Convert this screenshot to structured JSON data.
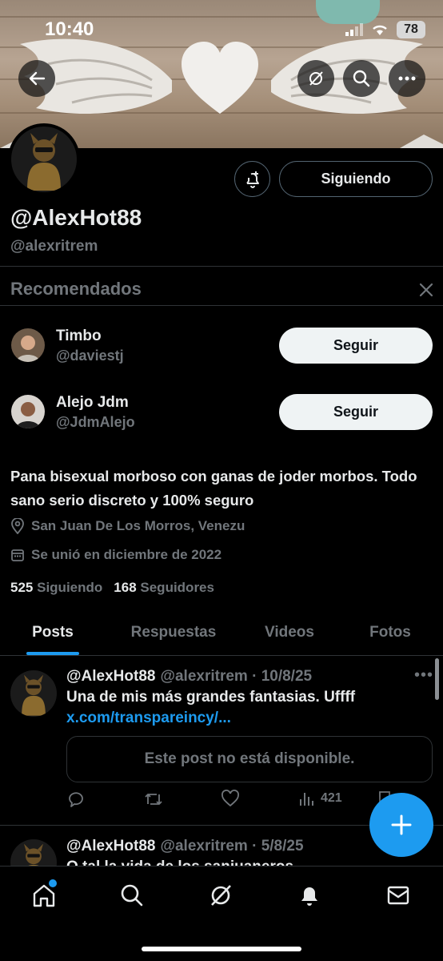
{
  "status_bar": {
    "time": "10:40",
    "battery": "78"
  },
  "profile": {
    "display_name": "@AlexHot88",
    "handle": "@alexritrem",
    "follow_state_label": "Siguiendo",
    "bio": "Pana bisexual morboso con ganas de joder morbos. Todo sano serio discreto y 100% seguro",
    "location": "San Juan De Los Morros, Venezu",
    "joined": "Se unió en diciembre de 2022",
    "following_count": "525",
    "following_label": "Siguiendo",
    "followers_count": "168",
    "followers_label": "Seguidores"
  },
  "recommended": {
    "title": "Recomendados",
    "users": [
      {
        "name": "Timbo",
        "handle": "@daviestj",
        "button": "Seguir"
      },
      {
        "name": "Alejo Jdm",
        "handle": "@JdmAlejo",
        "button": "Seguir"
      }
    ]
  },
  "tabs": [
    {
      "label": "Posts",
      "active": true
    },
    {
      "label": "Respuestas",
      "active": false
    },
    {
      "label": "Videos",
      "active": false
    },
    {
      "label": "Fotos",
      "active": false
    }
  ],
  "posts": [
    {
      "name": "@AlexHot88",
      "handle_date": "@alexritrem · 10/8/25",
      "text": "Una de mis más grandes fantasias. Uffff",
      "link": "x.com/transpareincy/...",
      "unavailable": "Este post no está disponible.",
      "views": "421"
    },
    {
      "name": "@AlexHot88",
      "handle_date": "@alexritrem · 5/8/25",
      "text": "O tal la vida de los sanjuaneros"
    }
  ],
  "icons": {
    "back": "back-arrow-icon",
    "grok": "grok-icon",
    "search": "search-icon",
    "more": "more-icon",
    "notify": "bell-plus-icon",
    "close": "close-icon",
    "location": "location-pin-icon",
    "calendar": "calendar-icon",
    "compose": "plus-icon"
  },
  "colors": {
    "accent": "#1d9bf0",
    "background": "#000000",
    "muted": "#71767b"
  }
}
